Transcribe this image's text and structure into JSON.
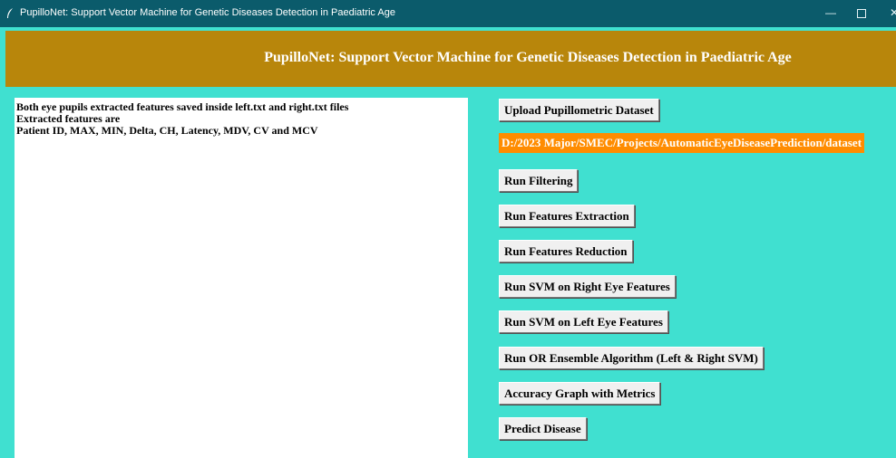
{
  "window": {
    "title": "PupilloNet: Support Vector Machine for Genetic Diseases Detection in Paediatric Age",
    "minimize_glyph": "—",
    "close_glyph": "✕"
  },
  "header": {
    "title": "PupilloNet: Support Vector Machine for Genetic Diseases Detection in Paediatric Age"
  },
  "output": {
    "lines": [
      "Both eye pupils extracted features saved inside left.txt and right.txt files",
      "Extracted features are",
      "Patient ID, MAX, MIN, Delta, CH, Latency, MDV, CV and MCV"
    ]
  },
  "controls": {
    "upload_label": "Upload Pupillometric Dataset",
    "dataset_path": "D:/2023 Major/SMEC/Projects/AutomaticEyeDiseasePrediction/dataset",
    "filtering_label": "Run Filtering",
    "extraction_label": "Run Features Extraction",
    "reduction_label": "Run Features Reduction",
    "svm_right_label": "Run SVM on Right Eye Features",
    "svm_left_label": "Run SVM on Left Eye Features",
    "ensemble_label": "Run OR Ensemble Algorithm (Left & Right SVM)",
    "graph_label": "Accuracy Graph with Metrics",
    "predict_label": "Predict Disease"
  },
  "colors": {
    "background": "#40e0d0",
    "header": "#b8860b",
    "path_highlight": "#ff8c00",
    "titlebar": "#0b5b6b"
  },
  "icons": {
    "app": "feather-icon",
    "minimize": "minimize-icon",
    "maximize": "maximize-icon",
    "close": "close-icon"
  }
}
